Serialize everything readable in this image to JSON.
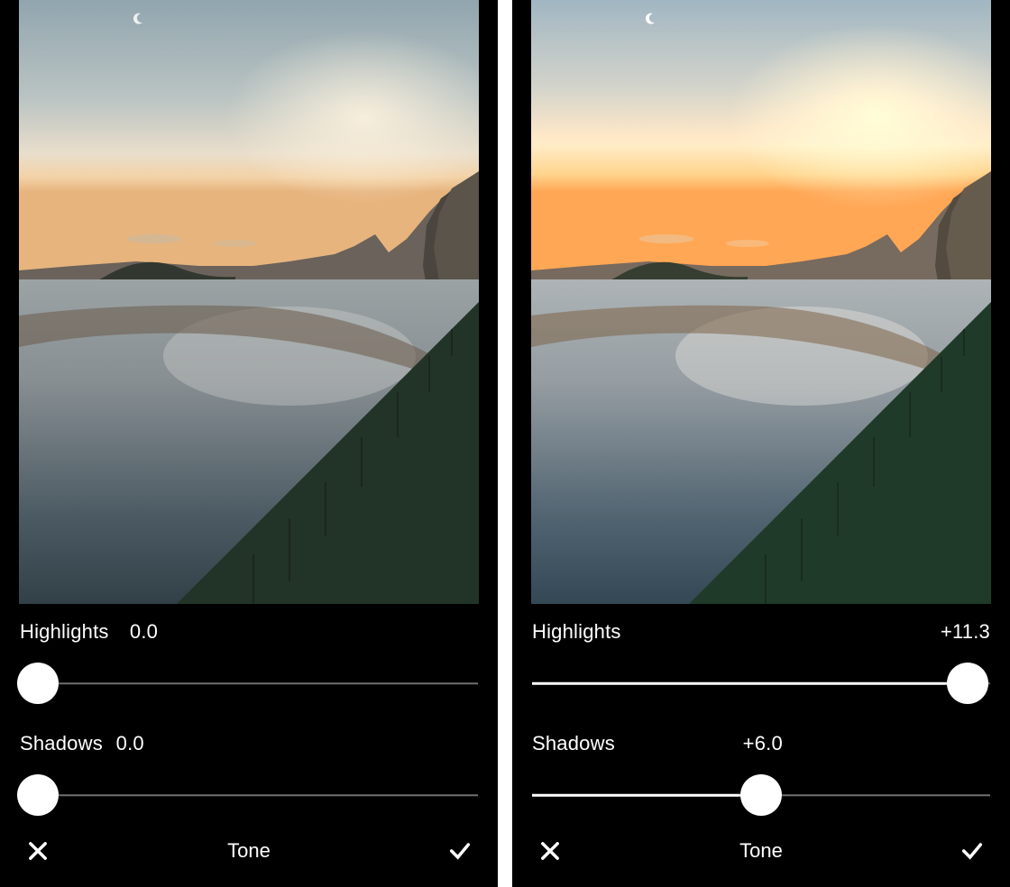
{
  "panels": [
    {
      "image": {
        "brightness": 1.0,
        "saturation": 1.0
      },
      "sliders": {
        "highlights": {
          "label": "Highlights",
          "value": "0.0",
          "pos": 0,
          "value_left_pct": 24
        },
        "shadows": {
          "label": "Shadows",
          "value": "0.0",
          "pos": 0,
          "value_left_pct": 21
        }
      },
      "footer": {
        "title": "Tone",
        "cancel_icon": "close-icon",
        "confirm_icon": "check-icon"
      }
    },
    {
      "image": {
        "brightness": 1.08,
        "saturation": 1.15
      },
      "sliders": {
        "highlights": {
          "label": "Highlights",
          "value": "+11.3",
          "pos": 94,
          "value_right": true
        },
        "shadows": {
          "label": "Shadows",
          "value": "+6.0",
          "pos": 50,
          "value_left_pct": 46
        }
      },
      "footer": {
        "title": "Tone",
        "cancel_icon": "close-icon",
        "confirm_icon": "check-icon"
      }
    }
  ]
}
